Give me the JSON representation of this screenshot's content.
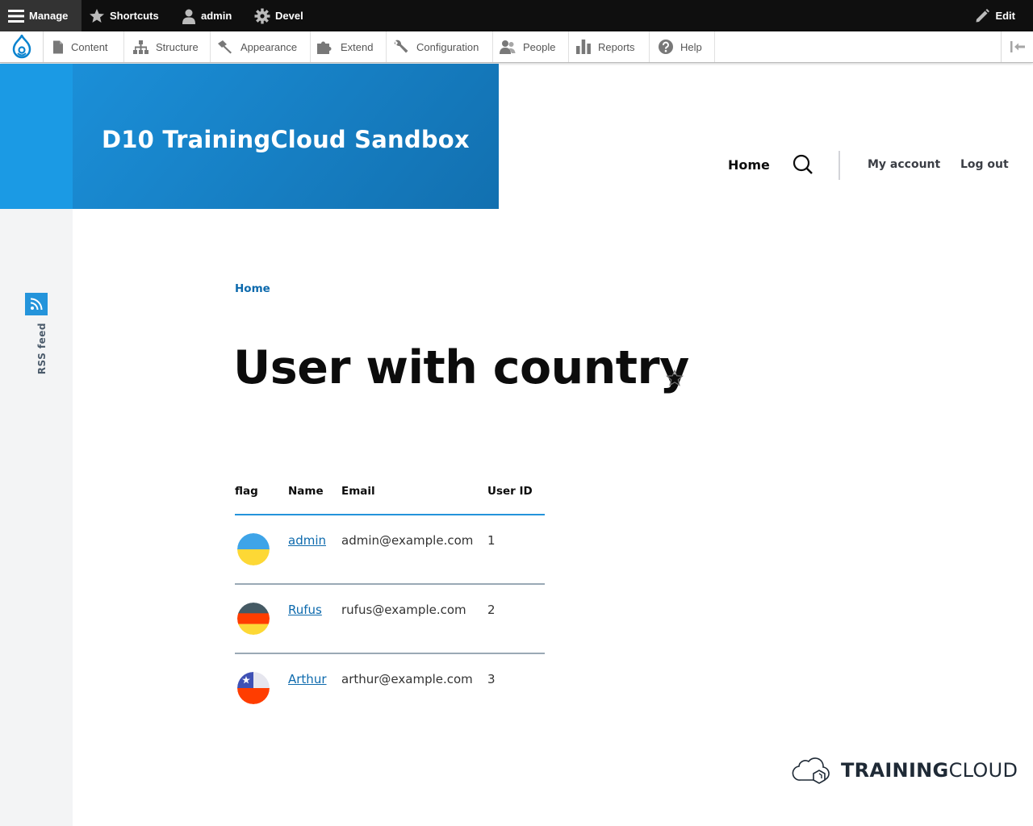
{
  "toolbar": {
    "manage": "Manage",
    "shortcuts": "Shortcuts",
    "user": "admin",
    "devel": "Devel",
    "edit": "Edit"
  },
  "tray": {
    "items": [
      {
        "label": "Content",
        "icon": "file-icon"
      },
      {
        "label": "Structure",
        "icon": "sitemap-icon"
      },
      {
        "label": "Appearance",
        "icon": "paintbrush-icon"
      },
      {
        "label": "Extend",
        "icon": "puzzle-icon"
      },
      {
        "label": "Configuration",
        "icon": "wrench-icon"
      },
      {
        "label": "People",
        "icon": "people-icon"
      },
      {
        "label": "Reports",
        "icon": "bar-chart-icon"
      },
      {
        "label": "Help",
        "icon": "help-icon"
      }
    ]
  },
  "site": {
    "name": "D10 TrainingCloud Sandbox"
  },
  "nav": {
    "home": "Home",
    "account": "My account",
    "logout": "Log out"
  },
  "sidebar": {
    "rss": "RSS feed"
  },
  "breadcrumb": {
    "home": "Home"
  },
  "page": {
    "title": "User with country"
  },
  "table": {
    "headers": [
      "flag",
      "Name",
      "Email",
      "User ID"
    ],
    "rows": [
      {
        "flag": "Ukraine",
        "name": "admin",
        "email": "admin@example.com",
        "uid": "1"
      },
      {
        "flag": "Germany",
        "name": "Rufus",
        "email": "rufus@example.com",
        "uid": "2"
      },
      {
        "flag": "Chile",
        "name": "Arthur",
        "email": "arthur@example.com",
        "uid": "3"
      }
    ]
  },
  "footer": {
    "brand_bold": "TRAINING",
    "brand_light": "CLOUD"
  },
  "colors": {
    "brand_blue": "#1b8fd8",
    "link_blue": "#0d6aad",
    "toolbar_black": "#0f0f0f"
  }
}
